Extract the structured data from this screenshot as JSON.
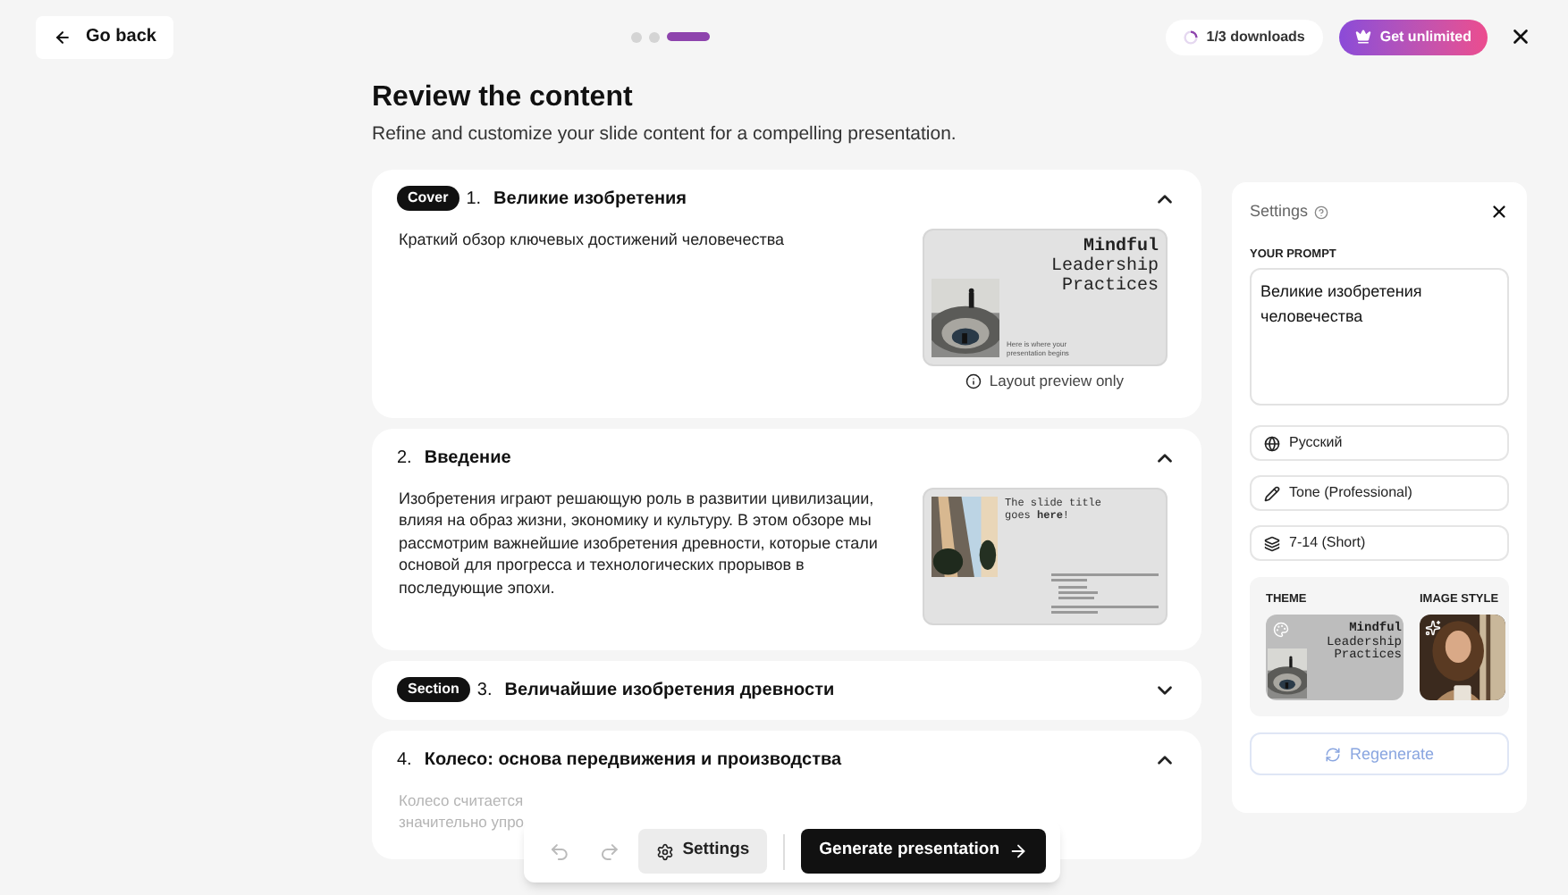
{
  "header": {
    "back": "Go back",
    "steps": [
      {
        "selected": false
      },
      {
        "selected": false
      },
      {
        "selected": true
      }
    ],
    "downloads": "1/3 downloads",
    "upgrade": "Get unlimited"
  },
  "title": "Review the content",
  "subtitle": "Refine and customize your slide content for a compelling presentation.",
  "slides": [
    {
      "badge": "Cover",
      "number": "1.",
      "title": "Великие изобретения",
      "expanded": true,
      "faded": false,
      "body": [
        "Краткий обзор ключевых достижений человечества"
      ],
      "preview": {
        "kind": "cover",
        "heading": [
          "Mindful",
          "Leadership",
          "Practices"
        ],
        "caption": "Here is where your presentation begins"
      },
      "note": "Layout preview only"
    },
    {
      "number": "2.",
      "title": "Введение",
      "expanded": true,
      "faded": false,
      "body": [
        "Изобретения играют решающую роль в развитии цивилизации, влияя на образ жизни, экономику и культуру. В этом обзоре мы рассмотрим важнейшие изобретения древности, которые стали основой для прогресса и технологических прорывов в последующие эпохи."
      ],
      "preview": {
        "kind": "content",
        "heading": [
          "The slide title",
          "goes **here**!"
        ]
      }
    },
    {
      "badge": "Section",
      "number": "3.",
      "title": "Величайшие изобретения древности",
      "expanded": false
    },
    {
      "number": "4.",
      "title": "Колесо: основа передвижения и производства",
      "expanded": true,
      "faded": true,
      "body": [
        "Колесо считается",
        "значительно упро"
      ]
    }
  ],
  "toolbar": {
    "settings": "Settings",
    "generate": "Generate presentation"
  },
  "settings": {
    "title": "Settings",
    "prompt_label": "YOUR PROMPT",
    "prompt": "Великие изобретения человечества",
    "options": [
      {
        "kind": "language",
        "label": "Русский"
      },
      {
        "kind": "tone",
        "label": "Tone (Professional)"
      },
      {
        "kind": "length",
        "label": "7-14 (Short)"
      }
    ],
    "theme_label": "THEME",
    "theme_heading": [
      "Mindful",
      "Leadership",
      "Practices"
    ],
    "image_style_label": "IMAGE STYLE",
    "regenerate": "Regenerate"
  }
}
